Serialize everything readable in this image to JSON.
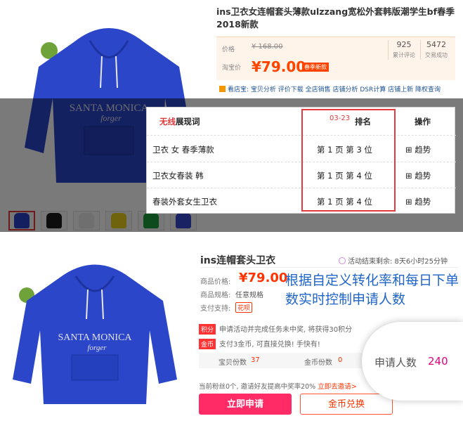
{
  "top": {
    "title": "ins卫衣女连帽套头薄款ulzzang宽松外套韩版潮学生bf春季2018新款",
    "price_label": "价格",
    "old_price": "¥ 168.00",
    "taobao_label": "淘宝价",
    "taobao_price": "¥79.00",
    "season_tag": "春季新款",
    "reviews_count": "925",
    "reviews_label": "累计评论",
    "sales_count": "5472",
    "sales_label": "交易成功",
    "tools": "看店宝: 宝贝分析 评价下载 全店销售 店铺分析 DSR计算 店铺上新 降权查询",
    "thumb_colors": [
      "#2a42c9",
      "#1c1c1c",
      "#e8e8e8",
      "#e9d21c",
      "#1e9e3b",
      "#3548cc"
    ]
  },
  "rank_table": {
    "header_prefix": "无线",
    "header_rest": "展现词",
    "date": "03-23",
    "rank_header": "排名",
    "action_header": "操作",
    "rows": [
      {
        "keyword": "卫衣 女 春季薄款",
        "rank": "第 1 页 第 3 位",
        "action": "⊞ 趋势"
      },
      {
        "keyword": "卫衣女春装 韩",
        "rank": "第 1 页 第 4 位",
        "action": "⊞ 趋势"
      },
      {
        "keyword": "春装外套女生卫衣",
        "rank": "第 1 页 第 4 位",
        "action": "⊞ 趋势"
      }
    ]
  },
  "hoodie_print": {
    "line1": "SANTA MONICA",
    "line2": "forger"
  },
  "bottom": {
    "title": "ins连帽套头卫衣",
    "countdown": "活动结束剩余: 8天6小时25分钟",
    "price_label": "商品价格:",
    "price": "¥79.00",
    "spec_label": "商品规格:",
    "spec_value": "任意规格",
    "pay_label": "支付支持:",
    "pay_value": "花呗",
    "note": "根据自定义转化率和每日下单数实时控制申请人数",
    "points_tag": "积分",
    "points_text": "申请活动并完成任务未中奖, 将获得30积分",
    "coin_tag": "金币",
    "coin_text": "支付3金币, 可直接兑换! 手快有!",
    "stock_label": "宝贝份数",
    "stock_value": "37",
    "coin_stock_label": "金币份数",
    "coin_stock_value": "0",
    "invite_text": "当前粉丝0个, 邀请好友提高中奖率20%",
    "invite_link": "立即去邀请>",
    "apply_button": "立即申请",
    "coin_button": "金币兑换",
    "applicants_label": "申请人数",
    "applicants_value": "240"
  }
}
